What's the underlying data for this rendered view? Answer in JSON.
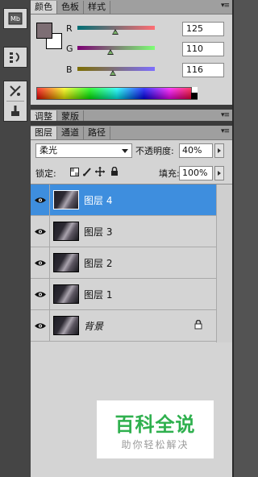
{
  "color_panel": {
    "tabs": [
      "颜色",
      "色板",
      "样式"
    ],
    "channels": [
      {
        "label": "R",
        "value": "125",
        "level": 0.49
      },
      {
        "label": "G",
        "value": "110",
        "level": 0.43
      },
      {
        "label": "B",
        "value": "116",
        "level": 0.455
      }
    ],
    "foreground_color": "#7d6e74",
    "background_color": "#ffffff"
  },
  "adjust_panel": {
    "tabs": [
      "调整",
      "蒙版"
    ]
  },
  "layers_panel": {
    "tabs": [
      "图层",
      "通道",
      "路径"
    ],
    "blend_mode": "柔光",
    "opacity_label": "不透明度:",
    "opacity_value": "40%",
    "lock_label": "锁定:",
    "fill_label": "填充:",
    "fill_value": "100%",
    "layers": [
      {
        "name": "图层 4",
        "selected": true
      },
      {
        "name": "图层 3",
        "selected": false
      },
      {
        "name": "图层 2",
        "selected": false
      },
      {
        "name": "图层 1",
        "selected": false
      },
      {
        "name": "背景",
        "selected": false,
        "locked": true
      }
    ]
  },
  "watermark": {
    "title": "百科全说",
    "subtitle": "助你轻松解决"
  },
  "icons": {
    "toolstrip": [
      "mini-bridge-icon",
      "history-icon",
      "brush-tools-icon",
      "clone-source-icon"
    ]
  }
}
